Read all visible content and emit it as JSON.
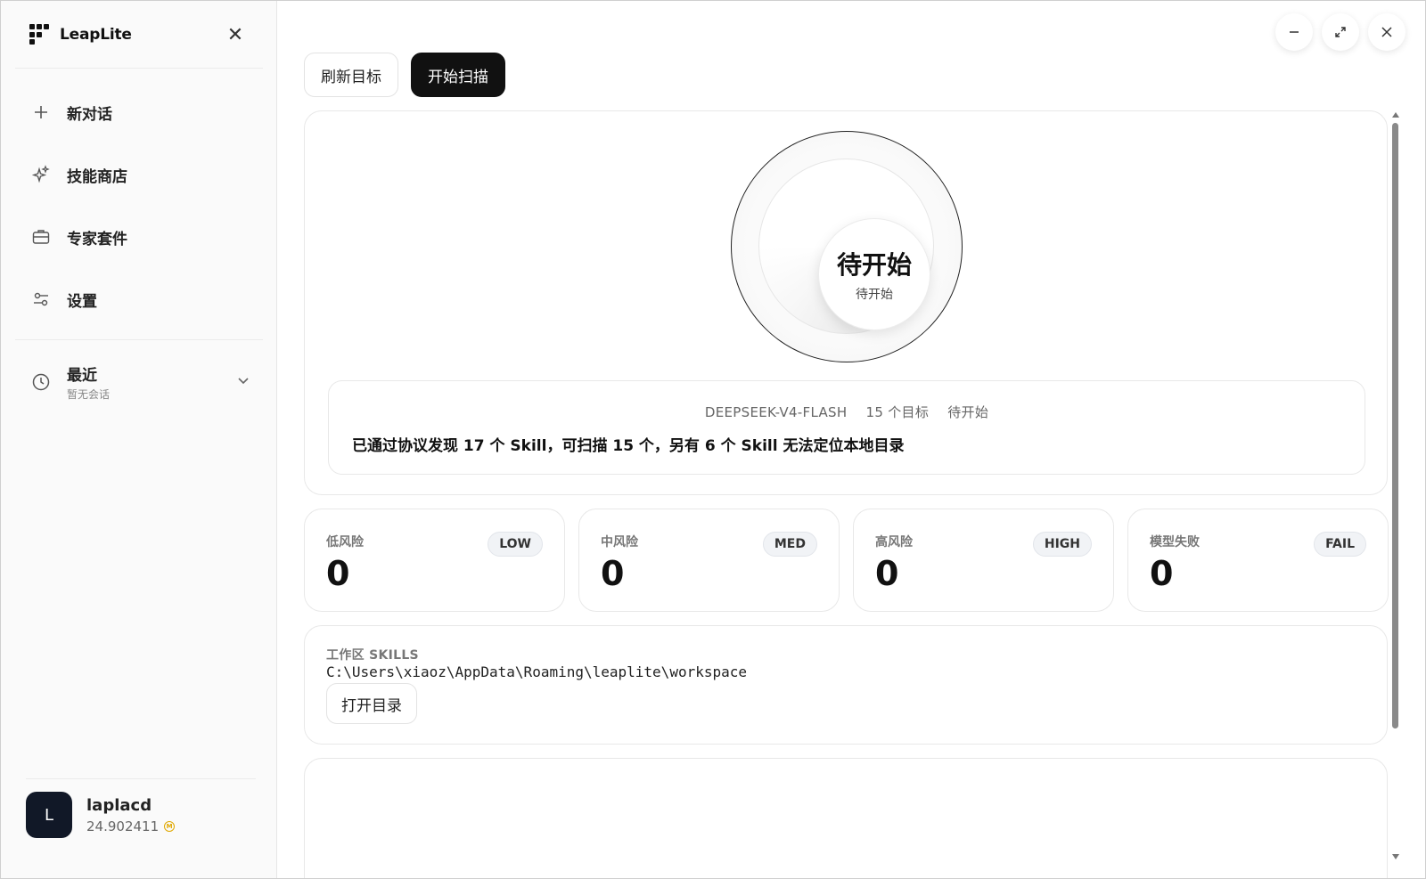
{
  "sidebar": {
    "brand": "LeapLite",
    "nav": [
      {
        "label": "新对话",
        "icon": "plus-icon"
      },
      {
        "label": "技能商店",
        "icon": "sparkles-icon"
      },
      {
        "label": "专家套件",
        "icon": "briefcase-icon"
      },
      {
        "label": "设置",
        "icon": "sliders-icon"
      }
    ],
    "recent": {
      "title": "最近",
      "subtitle": "暂无会话"
    },
    "user": {
      "initial": "L",
      "name": "laplacd",
      "balance": "24.902411",
      "coin": "M"
    }
  },
  "toolbar": {
    "refresh_label": "刷新目标",
    "scan_label": "开始扫描"
  },
  "scan": {
    "title": "待开始",
    "subtitle": "待开始",
    "model": "DEEPSEEK-V4-FLASH",
    "targets": "15 个目标",
    "status": "待开始",
    "summary": "已通过协议发现 17 个 Skill，可扫描 15 个，另有 6 个 Skill 无法定位本地目录"
  },
  "stats": [
    {
      "label": "低风险",
      "badge": "LOW",
      "value": "0"
    },
    {
      "label": "中风险",
      "badge": "MED",
      "value": "0"
    },
    {
      "label": "高风险",
      "badge": "HIGH",
      "value": "0"
    },
    {
      "label": "模型失败",
      "badge": "FAIL",
      "value": "0"
    }
  ],
  "workspace": {
    "label": "工作区 SKILLS",
    "path": "C:\\Users\\xiaoz\\AppData\\Roaming\\leaplite\\workspace",
    "open_label": "打开目录"
  }
}
